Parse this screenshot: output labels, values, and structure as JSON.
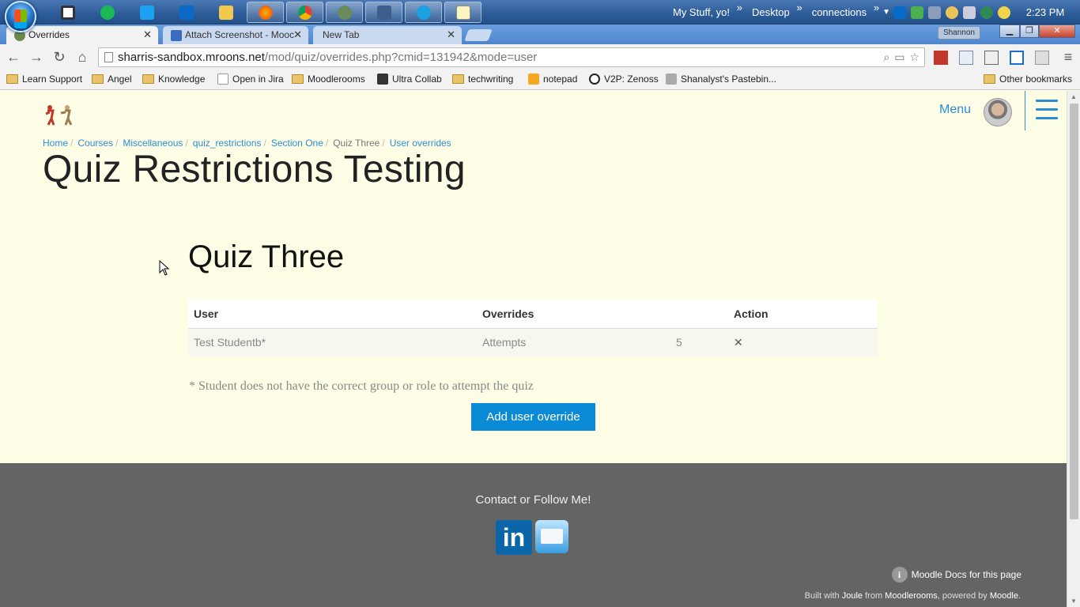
{
  "taskbar": {
    "links": [
      "My Stuff, yo!",
      "Desktop",
      "connections"
    ],
    "clock": "2:23 PM"
  },
  "tabs": [
    {
      "label": "Overrides"
    },
    {
      "label": "Attach Screenshot - Mooc"
    },
    {
      "label": "New Tab"
    }
  ],
  "profile_name": "Shannon",
  "address": {
    "host": "sharris-sandbox.mroons.net",
    "path": "/mod/quiz/overrides.php?cmid=131942&mode=user"
  },
  "bookmarks": [
    "Learn Support",
    "Angel",
    "Knowledge",
    "Open in Jira",
    "Moodlerooms",
    "Ultra Collab",
    "techwriting",
    "notepad",
    "V2P: Zenoss",
    "Shanalyst's Pastebin...",
    "Other bookmarks"
  ],
  "header": {
    "menu_label": "Menu"
  },
  "breadcrumb": [
    "Home",
    "Courses",
    "Miscellaneous",
    "quiz_restrictions",
    "Section One",
    "Quiz Three",
    "User overrides"
  ],
  "course_title": "Quiz Restrictions Testing",
  "quiz_title": "Quiz Three",
  "table": {
    "headers": [
      "User",
      "Overrides",
      "Action"
    ],
    "rows": [
      {
        "user": "Test Studentb*",
        "override": "Attempts",
        "value": "5",
        "action": "✕"
      }
    ]
  },
  "note": "* Student does not have the correct group or role to attempt the quiz",
  "add_button_label": "Add user override",
  "footer": {
    "contact": "Contact  or Follow Me!",
    "linkedin": "in",
    "docs_link": "Moodle Docs for this page",
    "built": {
      "prefix": "Built with",
      "joule": "Joule",
      "from": "from",
      "moodlerooms": "Moodlerooms",
      "powered": ", powered by",
      "moodle": "Moodle",
      "end": "."
    }
  },
  "colors": {
    "accent": "#0b8bd6",
    "link": "#2a8ed6",
    "page_bg": "#fefee6",
    "footer_bg": "#646464"
  }
}
